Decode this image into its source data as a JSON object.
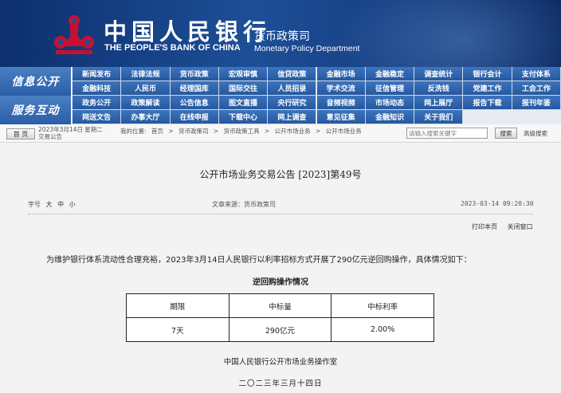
{
  "header": {
    "bank_name_cn": "中国人民银行",
    "bank_name_en": "THE PEOPLE'S BANK OF CHINA",
    "dept_cn": "货币政策司",
    "dept_en": "Monetary Policy Department",
    "colors": {
      "banner": "#1d4f97",
      "nav": "#2a5ea7"
    }
  },
  "nav": {
    "group1_label": "信息公开",
    "group2_label": "服务互动",
    "rows": [
      [
        "新闻发布",
        "法律法规",
        "货币政策",
        "宏观审慎",
        "信贷政策",
        "金融市场",
        "金融稳定",
        "调查统计",
        "银行会计",
        "支付体系"
      ],
      [
        "金融科技",
        "人民币",
        "经理国库",
        "国际交往",
        "人员招录",
        "学术交流",
        "征信管理",
        "反洗钱",
        "党建工作",
        "工会工作"
      ],
      [
        "政务公开",
        "政策解读",
        "公告信息",
        "图文直播",
        "央行研究",
        "音频视频",
        "市场动态",
        "网上展厅",
        "报告下载",
        "报刊年鉴"
      ],
      [
        "网送文告",
        "办事大厅",
        "在线申报",
        "下载中心",
        "网上调查",
        "意见征集",
        "金融知识",
        "关于我们"
      ]
    ]
  },
  "crumbbar": {
    "home": "首 页",
    "date": "2023年3月14日 星期二",
    "page": "交易公告",
    "location_prefix": "我的位置:",
    "crumbs": [
      "首页",
      ">",
      "货币政策司",
      ">",
      "货币政策工具",
      ">",
      "公开市场业务",
      ">",
      "公开市场业务"
    ],
    "search_placeholder": "请输入搜索关键字",
    "search_button": "搜索",
    "advanced_search": "高级搜索"
  },
  "article": {
    "title": "公开市场业务交易公告 [2023]第49号",
    "fontsize_label": "字号",
    "fontsize_options": [
      "大",
      "中",
      "小"
    ],
    "source": "文章来源：货币政策司",
    "time": "2023-03-14 09:20:30",
    "print": "打印本页",
    "close": "关闭窗口",
    "paragraph": "为维护银行体系流动性合理充裕，2023年3月14日人民银行以利率招标方式开展了290亿元逆回购操作，具体情况如下：",
    "table_caption": "逆回购操作情况",
    "table_headers": [
      "期限",
      "中标量",
      "中标利率"
    ],
    "table_row": [
      "7天",
      "290亿元",
      "2.00%"
    ],
    "signoff": "中国人民银行公开市场业务操作室",
    "signdate": "二〇二三年三月十四日"
  }
}
